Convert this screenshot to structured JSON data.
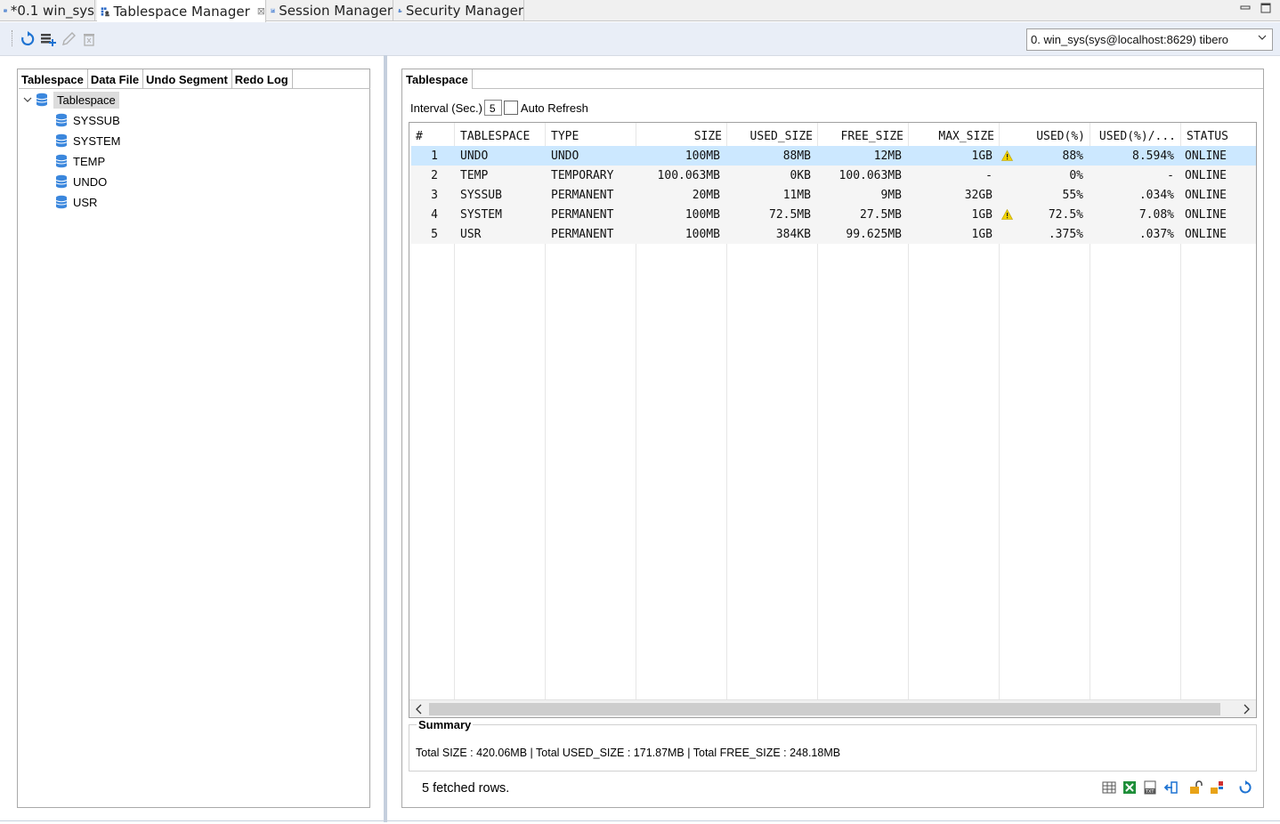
{
  "editor_tabs": [
    {
      "label": "*0.1 win_sys",
      "icon": "sql-file-icon"
    },
    {
      "label": "Tablespace Manager",
      "icon": "tablespace-manager-icon",
      "active": true
    },
    {
      "label": "Session Manager",
      "icon": "session-manager-icon"
    },
    {
      "label": "Security Manager",
      "icon": "security-manager-icon"
    }
  ],
  "toolbar": {
    "icons": [
      "refresh-icon",
      "add-datafile-icon",
      "edit-icon",
      "delete-icon"
    ]
  },
  "connection": {
    "selected": "0. win_sys(sys@localhost:8629) tibero"
  },
  "left_panel": {
    "tabs": [
      "Tablespace",
      "Data File",
      "Undo Segment",
      "Redo Log"
    ],
    "tree": {
      "root": "Tablespace",
      "children": [
        "SYSSUB",
        "SYSTEM",
        "TEMP",
        "UNDO",
        "USR"
      ]
    }
  },
  "right_panel": {
    "tab": "Tablespace",
    "interval_label": "Interval (Sec.)",
    "interval_value": "5",
    "auto_refresh_label": "Auto Refresh",
    "auto_refresh_checked": false
  },
  "table": {
    "columns": [
      "#",
      "TABLESPACE",
      "TYPE",
      "SIZE",
      "USED_SIZE",
      "FREE_SIZE",
      "MAX_SIZE",
      "USED(%)",
      "USED(%)/...",
      "STATUS"
    ],
    "rows": [
      [
        "1",
        "UNDO",
        "UNDO",
        "100MB",
        "88MB",
        "12MB",
        "1GB",
        "88%",
        "8.594%",
        "ONLINE"
      ],
      [
        "2",
        "TEMP",
        "TEMPORARY",
        "100.063MB",
        "0KB",
        "100.063MB",
        "-",
        "0%",
        "-",
        "ONLINE"
      ],
      [
        "3",
        "SYSSUB",
        "PERMANENT",
        "20MB",
        "11MB",
        "9MB",
        "32GB",
        "55%",
        ".034%",
        "ONLINE"
      ],
      [
        "4",
        "SYSTEM",
        "PERMANENT",
        "100MB",
        "72.5MB",
        "27.5MB",
        "1GB",
        "72.5%",
        "7.08%",
        "ONLINE"
      ],
      [
        "5",
        "USR",
        "PERMANENT",
        "100MB",
        "384KB",
        "99.625MB",
        "1GB",
        ".375%",
        ".037%",
        "ONLINE"
      ]
    ],
    "warning_rows": [
      0,
      3
    ],
    "selected_row": 0
  },
  "summary": {
    "title": "Summary",
    "text": "Total SIZE : 420.06MB | Total USED_SIZE : 171.87MB | Total FREE_SIZE : 248.18MB"
  },
  "status": {
    "fetched": "5 fetched rows."
  },
  "bottom_icons": [
    "grid-view-icon",
    "excel-export-icon",
    "text-export-icon",
    "export-icon",
    "unlock-icon",
    "lock-grid-icon",
    "refresh-icon"
  ],
  "colors": {
    "selection": "#cce8ff",
    "toolbar_bg": "#e9eef7",
    "accent_blue": "#1e73d2",
    "warning": "#f2d300"
  }
}
